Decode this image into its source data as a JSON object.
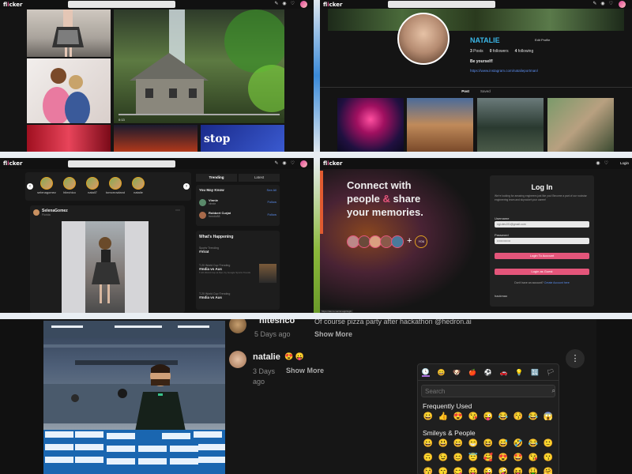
{
  "brand": {
    "logo_prefix": "fl",
    "logo_accent": "i",
    "logo_suffix": "cker",
    "accent_color": "#e04f8e"
  },
  "feed_view": {
    "video_time": "0:13"
  },
  "profile_view": {
    "name": "NATALIE",
    "edit_label": "Edit Profile",
    "posts": "3",
    "posts_label": "Posts",
    "followers": "0",
    "followers_label": "followers",
    "following": "4",
    "following_label": "following",
    "bio": "Be yourself!",
    "link": "https://www.instagram.com/natalieportman/",
    "tabs": [
      "Post",
      "Saved"
    ]
  },
  "home_view": {
    "stories": [
      "selenagomez",
      "hitechico",
      "natali7",
      "tomorrowland",
      "natalie"
    ],
    "post_author": "SelenaGomez",
    "post_location": "Florida",
    "right_tabs": [
      "Trending",
      "Latest"
    ],
    "you_may_know_title": "You May Know",
    "see_all": "See All",
    "suggestions": [
      {
        "name": "Vinnie",
        "sub": "vinnie",
        "action": "Follow"
      },
      {
        "name": "Robbert Curjat",
        "sub": "freediv88",
        "action": "Follow"
      }
    ],
    "happening_title": "What's Happening",
    "trends": [
      {
        "cat": "Sports·Trending",
        "tag": "#Virat"
      },
      {
        "cat": "T-20 World Cup·Trending",
        "tag": "#India vs Aus",
        "desc": "T-20 World Cup at 8pm by Google Sports Trends"
      },
      {
        "cat": "T-20 World Cup·Trending",
        "tag": "#India vs Aus"
      }
    ]
  },
  "login_view": {
    "nav_right": "Login",
    "headline_1": "Connect with",
    "headline_2a": "people",
    "headline_amp": "&",
    "headline_2b": "share",
    "headline_3": "your memories.",
    "you_label": "YOU",
    "title": "Log In",
    "blurb": "We're looking for amazing engineers just like you! Become a part of our rockstar engineering team and skyrocket your career!",
    "username_label": "Username",
    "username_value": "ngi.dev191@gmail.com",
    "password_label": "Password",
    "password_value": "••••••••••••••",
    "login_button": "Login To Account",
    "guest_button": "Login as Guest",
    "signup_text": "Don't have an account?",
    "signup_link": "Create Account here",
    "footer": "hackmao",
    "status_url": "https://demo.vercel.app/login"
  },
  "comment_view": {
    "comments": [
      {
        "user": "hiteshco",
        "text": "Of course pizza party after hackathon @hedron.ai",
        "time": "5 Days ago",
        "more": "Show More"
      },
      {
        "user": "natalie",
        "text": "😍 😛",
        "time": "3 Days ago",
        "more": "Show More"
      }
    ],
    "more_icon": "⋮",
    "picker": {
      "search_placeholder": "Search",
      "frequent_title": "Frequently Used",
      "frequent": [
        "😀",
        "👍",
        "😍",
        "😘",
        "😜",
        "😂",
        "😚",
        "😂",
        "😱"
      ],
      "smileys_title": "Smileys & People",
      "smileys_row1": [
        "😀",
        "😃",
        "😄",
        "😁",
        "😆",
        "😅",
        "🤣",
        "😂",
        "🙂"
      ],
      "smileys_row2": [
        "🙃",
        "😉",
        "😊",
        "😇",
        "🥰",
        "😍",
        "🤩",
        "😘",
        "😗"
      ],
      "smileys_row3": [
        "😚",
        "😙",
        "😋",
        "😛",
        "😜",
        "🤪",
        "😝",
        "🤑",
        "🤗"
      ],
      "category_icons": [
        "🕓",
        "😀",
        "🐶",
        "🍎",
        "⚽",
        "🚗",
        "💡",
        "🔣",
        "🏳"
      ]
    }
  }
}
